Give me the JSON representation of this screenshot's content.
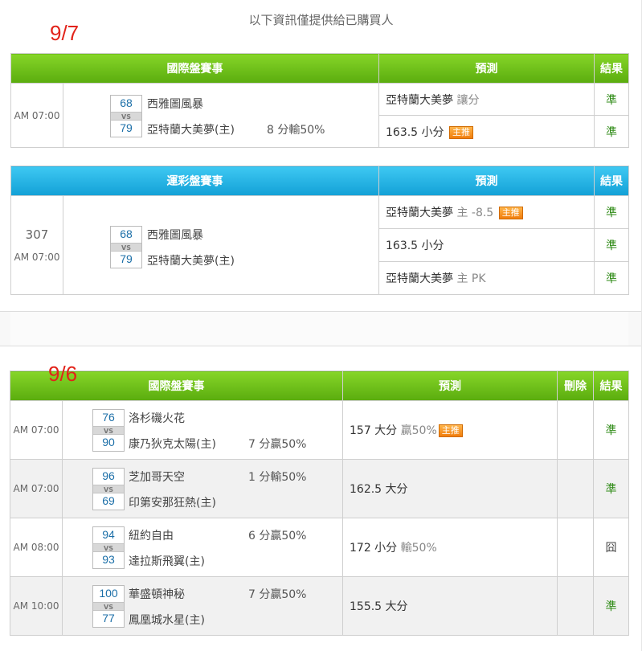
{
  "notice": "以下資訊僅提供給已購買人",
  "sections": {
    "d1": {
      "date": "9/7",
      "intl": {
        "headers": {
          "event": "國際盤賽事",
          "predict": "預測",
          "result": "結果"
        },
        "time": "AM 07:00",
        "away_score": "68",
        "home_score": "79",
        "vs": "VS",
        "away_team": "西雅圖風暴",
        "home_team": "亞特蘭大美夢(主)",
        "note": "8 分輸50%",
        "preds": [
          {
            "main": "亞特蘭大美夢",
            "extra": "讓分",
            "badge": "",
            "result": "準"
          },
          {
            "main": "163.5 小分",
            "extra": "",
            "badge": "主推",
            "result": "準"
          }
        ]
      },
      "lottery": {
        "headers": {
          "event": "運彩盤賽事",
          "predict": "預測",
          "result": "結果"
        },
        "game_no": "307",
        "time": "AM 07:00",
        "away_score": "68",
        "home_score": "79",
        "vs": "VS",
        "away_team": "西雅圖風暴",
        "home_team": "亞特蘭大美夢(主)",
        "preds": [
          {
            "main": "亞特蘭大美夢",
            "extra": "主 -8.5",
            "badge": "主推",
            "result": "準"
          },
          {
            "main": "163.5 小分",
            "extra": "",
            "badge": "",
            "result": "準"
          },
          {
            "main": "亞特蘭大美夢",
            "extra": "主 PK",
            "badge": "",
            "result": "準"
          }
        ]
      }
    },
    "d2": {
      "date": "9/6",
      "headers": {
        "event": "國際盤賽事",
        "predict": "預測",
        "delete": "刪除",
        "result": "結果"
      },
      "games": [
        {
          "time": "AM 07:00",
          "away_score": "76",
          "home_score": "90",
          "vs": "VS",
          "away_team": "洛杉磯火花",
          "home_team": "康乃狄克太陽(主)",
          "note": "7 分贏50%",
          "pred": "157 大分",
          "extra": "贏50%",
          "badge": "主推",
          "result": "準"
        },
        {
          "time": "AM 07:00",
          "away_score": "96",
          "home_score": "69",
          "vs": "VS",
          "away_team": "芝加哥天空",
          "home_team": "印第安那狂熱(主)",
          "note": "1 分輸50%",
          "pred": "162.5 大分",
          "extra": "",
          "badge": "",
          "result": "準"
        },
        {
          "time": "AM 08:00",
          "away_score": "94",
          "home_score": "93",
          "vs": "VS",
          "away_team": "紐約自由",
          "home_team": "達拉斯飛翼(主)",
          "note": "6 分贏50%",
          "pred": "172 小分",
          "extra": "輸50%",
          "badge": "",
          "result": "囧"
        },
        {
          "time": "AM 10:00",
          "away_score": "100",
          "home_score": "77",
          "vs": "VS",
          "away_team": "華盛頓神秘",
          "home_team": "鳳凰城水星(主)",
          "note": "7 分贏50%",
          "pred": "155.5 大分",
          "extra": "",
          "badge": "",
          "result": "準"
        }
      ]
    }
  },
  "colors": {
    "green_header": "#6cbc1c",
    "blue_header": "#27b1e0",
    "date_red": "#e2231a",
    "result_green": "#2d8a14",
    "badge_orange": "#f07d0c"
  }
}
